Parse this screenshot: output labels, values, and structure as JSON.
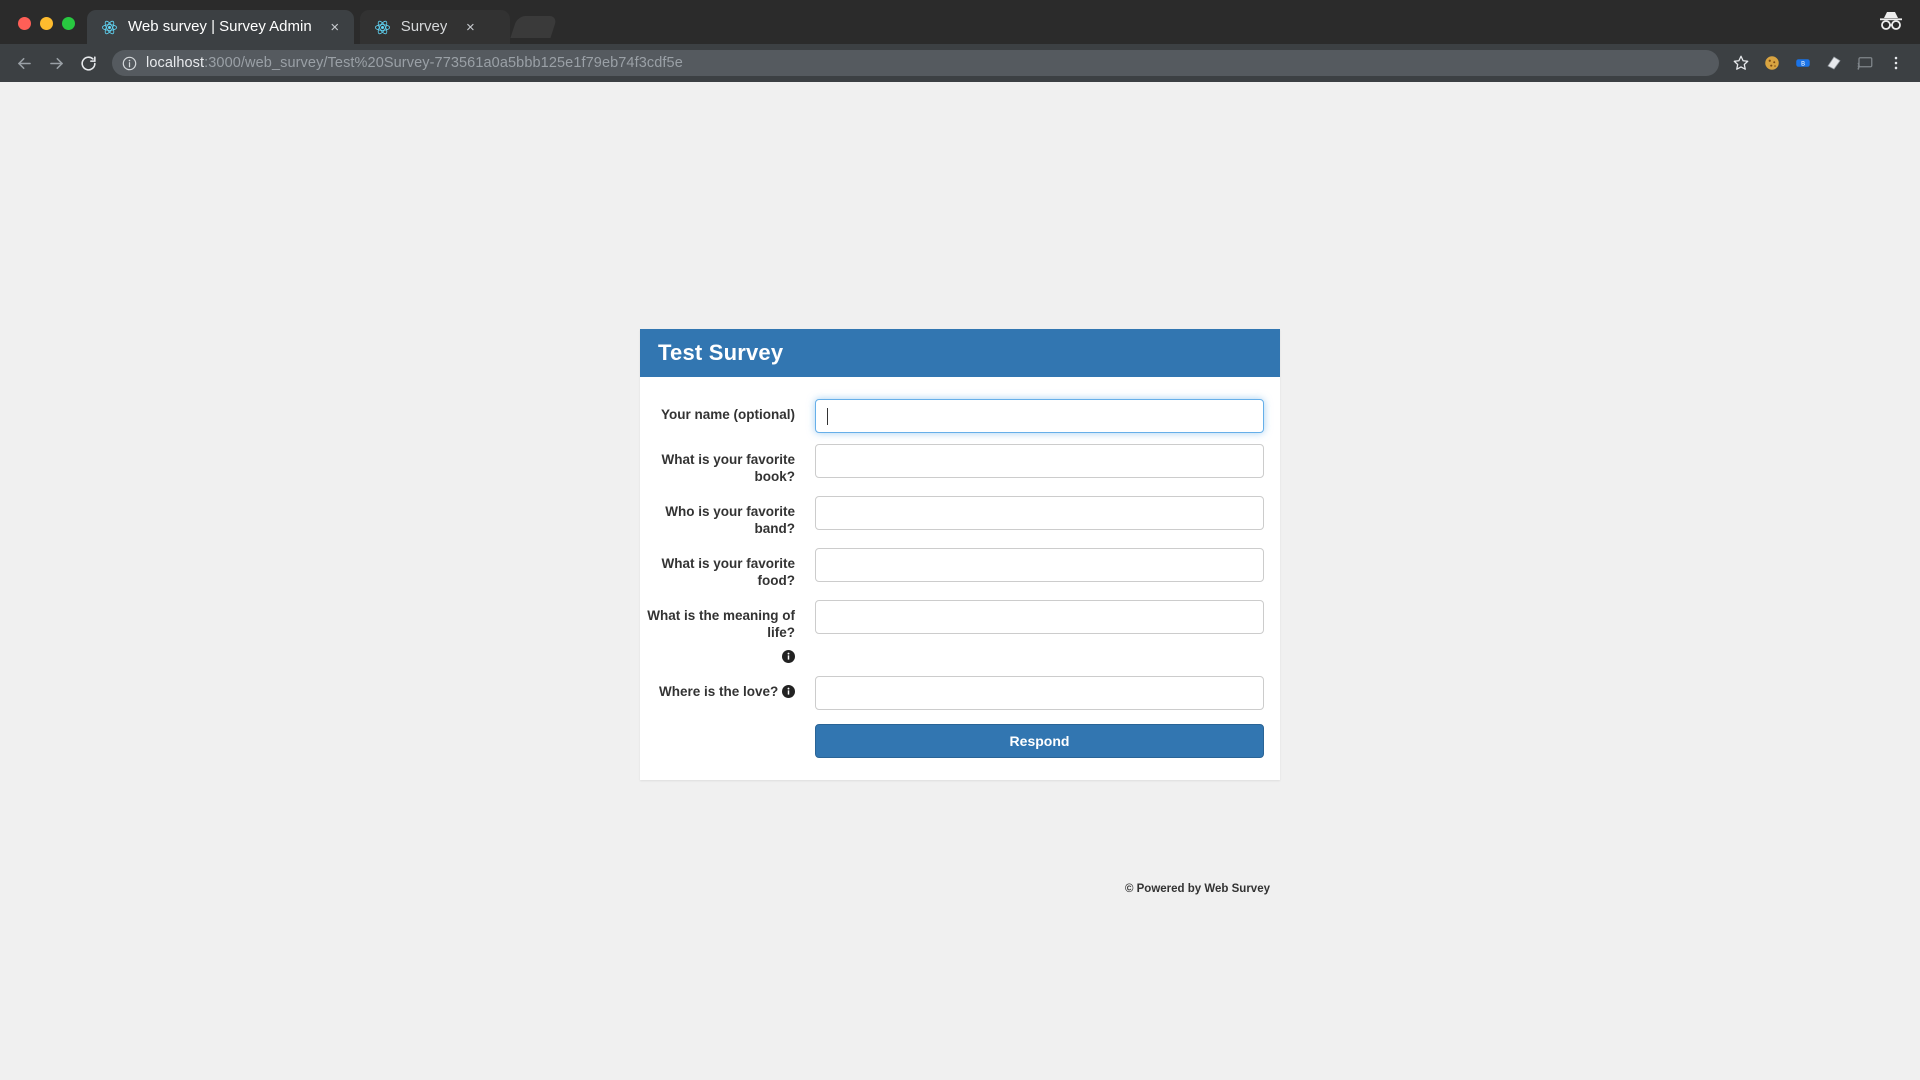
{
  "browser": {
    "tabs": [
      {
        "title": "Web survey | Survey Admin",
        "favicon": "react-icon",
        "close_label": "×",
        "active": true
      },
      {
        "title": "Survey",
        "favicon": "react-icon",
        "close_label": "×",
        "active": false
      }
    ],
    "nav": {
      "back_label": "←",
      "forward_label": "→",
      "reload_label": "⟳"
    },
    "omnibox": {
      "info_icon": "info-circle-icon",
      "url_host": "localhost",
      "url_rest": ":3000/web_survey/Test%20Survey-773561a0a5bbb125e1f79eb74f3cdf5e",
      "url_full": "localhost:3000/web_survey/Test%20Survey-773561a0a5bbb125e1f79eb74f3cdf5e"
    },
    "toolbar_icons": [
      "bookmark-star-icon",
      "cookie-extension-icon",
      "bluetooth-extension-icon",
      "notes-extension-icon",
      "cast-icon",
      "chrome-menu-icon"
    ],
    "incognito_icon": "incognito-icon"
  },
  "survey": {
    "title": "Test Survey",
    "fields": [
      {
        "label": "Your name (optional)",
        "value": "",
        "placeholder": "",
        "focused": true,
        "info_icon": false,
        "info_icon_own_line": false
      },
      {
        "label": "What is your favorite book?",
        "value": "",
        "placeholder": "",
        "focused": false,
        "info_icon": false,
        "info_icon_own_line": false
      },
      {
        "label": "Who is your favorite band?",
        "value": "",
        "placeholder": "",
        "focused": false,
        "info_icon": false,
        "info_icon_own_line": false
      },
      {
        "label": "What is your favorite food?",
        "value": "",
        "placeholder": "",
        "focused": false,
        "info_icon": false,
        "info_icon_own_line": false
      },
      {
        "label": "What is the meaning of life?",
        "value": "",
        "placeholder": "",
        "focused": false,
        "info_icon": true,
        "info_icon_own_line": true
      },
      {
        "label": "Where is the love?",
        "value": "",
        "placeholder": "",
        "focused": false,
        "info_icon": true,
        "info_icon_own_line": false
      }
    ],
    "submit_label": "Respond",
    "footer": "© Powered by Web Survey",
    "accent_color": "#3276b1",
    "focus_color": "#66afe9",
    "page_background": "#f0f0f0"
  }
}
